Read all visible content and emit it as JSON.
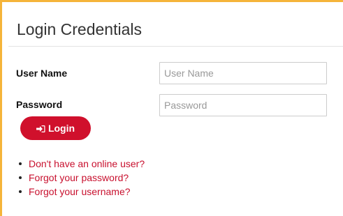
{
  "panel": {
    "title": "Login Credentials",
    "accent_color": "#f5b43a"
  },
  "form": {
    "username": {
      "label": "User Name",
      "placeholder": "User Name",
      "value": ""
    },
    "password": {
      "label": "Password",
      "placeholder": "Password",
      "value": ""
    },
    "login_button": {
      "label": "Login",
      "icon": "sign-in-icon",
      "color": "#d0102c"
    }
  },
  "links": [
    {
      "label": "Don't have an online user?"
    },
    {
      "label": "Forgot your password?"
    },
    {
      "label": "Forgot your username?"
    }
  ],
  "link_color": "#c8102e"
}
